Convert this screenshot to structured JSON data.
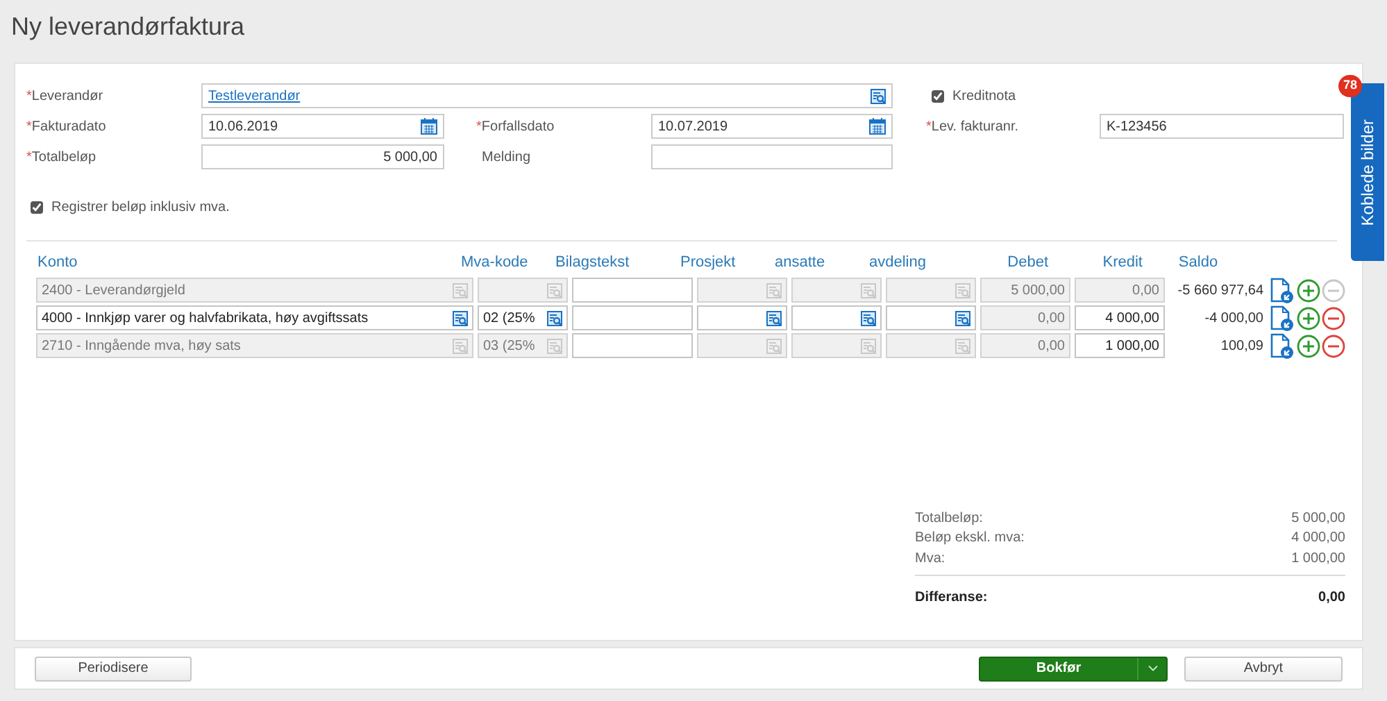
{
  "title": "Ny leverandørfaktura",
  "form": {
    "supplier": {
      "label": "Leverandør",
      "required_mark": "*",
      "value": "Testleverandør"
    },
    "invoice_date": {
      "label": "Fakturadato",
      "required_mark": "*",
      "value": "10.06.2019"
    },
    "due_date": {
      "label": "Forfallsdato",
      "required_mark": "*",
      "value": "10.07.2019"
    },
    "supplier_invoice_no": {
      "label": "Lev. fakturanr.",
      "required_mark": "*",
      "value": "K-123456"
    },
    "total": {
      "label": "Totalbeløp",
      "required_mark": "*",
      "value": "5 000,00"
    },
    "message": {
      "label": "Melding"
    },
    "credit_note": {
      "label": "Kreditnota",
      "checked": true
    },
    "incl_vat": {
      "label": "Registrer beløp inklusiv mva.",
      "checked": true
    }
  },
  "table": {
    "columns": [
      {
        "label": "Konto",
        "kind": "text"
      },
      {
        "label": "Mva-kode",
        "kind": "text"
      },
      {
        "label": "Bilagstekst",
        "kind": "text"
      },
      {
        "label": "Prosjekt",
        "kind": "text"
      },
      {
        "label": "ansatte",
        "kind": "text"
      },
      {
        "label": "avdeling",
        "kind": "text"
      },
      {
        "label": "Debet",
        "kind": "amount"
      },
      {
        "label": "Kredit",
        "kind": "amount"
      },
      {
        "label": "Saldo",
        "kind": "saldo"
      }
    ],
    "rows": [
      {
        "cells": [
          {
            "value": "2400 - Leverandørgjeld",
            "disabled": true,
            "lookup": true
          },
          {
            "disabled": true,
            "lookup": true
          },
          {
            "disabled": false
          },
          {
            "disabled": true,
            "lookup": true
          },
          {
            "disabled": true,
            "lookup": true
          },
          {
            "disabled": true,
            "lookup": true
          },
          {
            "value": "5 000,00",
            "disabled": true
          },
          {
            "value": "0,00",
            "disabled": true
          }
        ],
        "saldo": "-5 660 977,64",
        "remove_disabled": true
      },
      {
        "cells": [
          {
            "value": "4000 - Innkjøp varer og halvfabrikata, høy avgiftssats",
            "disabled": false,
            "lookup": true
          },
          {
            "value": "02 (25%",
            "disabled": false,
            "lookup": true
          },
          {
            "disabled": false
          },
          {
            "disabled": false,
            "lookup": true
          },
          {
            "disabled": false,
            "lookup": true
          },
          {
            "disabled": false,
            "lookup": true
          },
          {
            "value": "0,00",
            "disabled": true
          },
          {
            "value": "4 000,00",
            "disabled": false
          }
        ],
        "saldo": "-4 000,00",
        "remove_disabled": false
      },
      {
        "cells": [
          {
            "value": "2710 - Inngående mva, høy sats",
            "disabled": true,
            "lookup": true
          },
          {
            "value": "03 (25%",
            "disabled": true,
            "lookup": true
          },
          {
            "disabled": false
          },
          {
            "disabled": true,
            "lookup": true
          },
          {
            "disabled": true,
            "lookup": true
          },
          {
            "disabled": true,
            "lookup": true
          },
          {
            "value": "0,00",
            "disabled": true
          },
          {
            "value": "1 000,00",
            "disabled": false
          }
        ],
        "saldo": "100,09",
        "remove_disabled": false
      }
    ]
  },
  "summary": [
    {
      "label": "Totalbeløp:",
      "value": "5 000,00",
      "kind": "normal"
    },
    {
      "label": "Beløp ekskl. mva:",
      "value": "4 000,00",
      "kind": "normal"
    },
    {
      "label": "Mva:",
      "value": "1 000,00",
      "kind": "normal"
    },
    {
      "label": "Differanse:",
      "value": "0,00",
      "kind": "total"
    }
  ],
  "side_tab": {
    "label": "Koblede bilder",
    "badge": "78"
  },
  "footer": {
    "periodize": "Periodisere",
    "post": "Bokfør",
    "cancel": "Avbryt"
  }
}
